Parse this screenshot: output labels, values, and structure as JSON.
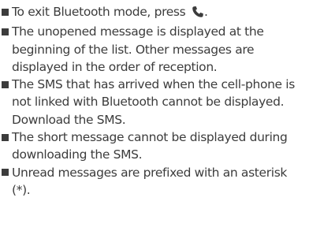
{
  "notes": [
    {
      "text": "To exit Bluetooth mode, press ",
      "trailing": "."
    },
    {
      "text": "The unopened message is displayed at the beginning of the list. Other messages are displayed in the order of reception."
    },
    {
      "text": "The SMS that has arrived when the cell-phone is not linked with Bluetooth cannot be displayed. Download the SMS."
    },
    {
      "text": "The short message cannot be displayed during downloading the SMS."
    },
    {
      "text": "Unread messages are prefixed with an asterisk (*)."
    }
  ],
  "icons": {
    "phone": "phone-handset-icon"
  }
}
